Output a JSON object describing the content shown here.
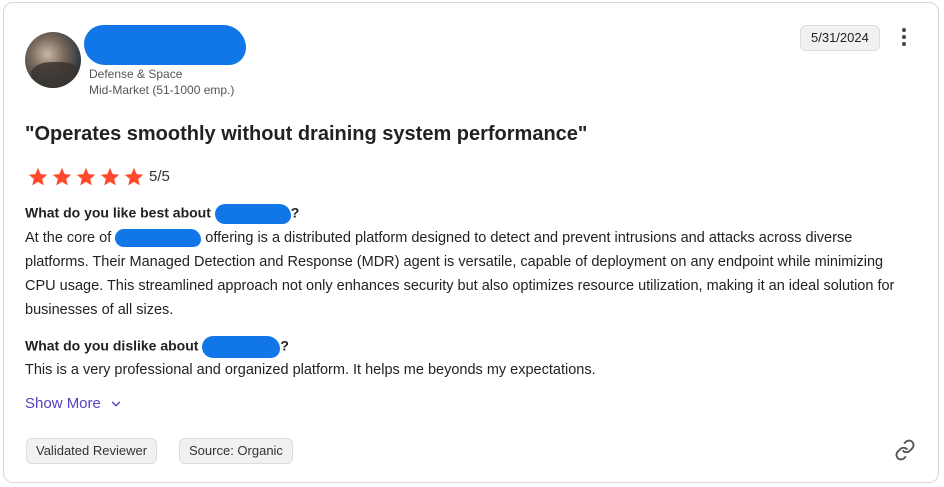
{
  "reviewer": {
    "industry": "Defense & Space",
    "company_size": "Mid-Market (51-1000 emp.)"
  },
  "date": "5/31/2024",
  "review": {
    "title": "\"Operates smoothly without draining system performance\"",
    "rating_text": "5/5",
    "rating_stars": 5,
    "q1_prefix": "What do you like best about ",
    "q1_suffix": "?",
    "a1_part1": "At the core of ",
    "a1_part2": " offering is a distributed platform designed to detect and prevent intrusions and attacks across diverse platforms. Their Managed Detection and Response (MDR) agent is versatile, capable of deployment on any endpoint while minimizing CPU usage. This streamlined approach not only enhances security but also optimizes resource utilization, making it an ideal solution for businesses of all sizes.",
    "q2_prefix": "What do you dislike about ",
    "q2_suffix": "?",
    "a2": "This is a very professional and organized platform. It helps me beyonds my expectations.",
    "show_more_label": "Show More"
  },
  "tags": [
    "Validated Reviewer",
    "Source: Organic"
  ],
  "colors": {
    "star": "#ff492c",
    "link": "#5a3fc0",
    "redaction": "#1177e8"
  },
  "icons": {
    "menu": "more-vertical-icon",
    "chevron": "chevron-down-icon",
    "link": "link-icon",
    "star": "star-icon"
  }
}
